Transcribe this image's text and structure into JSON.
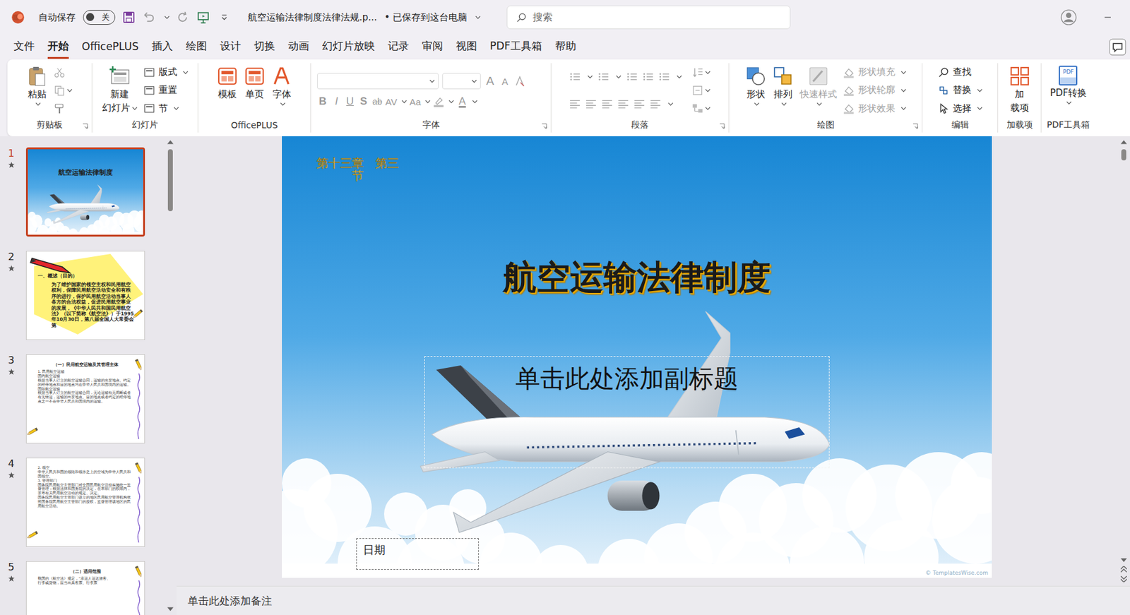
{
  "window": {
    "title": "航空运输法律制度法律法规.p...",
    "save_status": "• 已保存到这台电脑",
    "autosave": {
      "label": "自动保存",
      "toggle": "关",
      "on": false
    }
  },
  "search": {
    "placeholder": "搜索"
  },
  "menu": [
    {
      "label": "文件",
      "selected": false
    },
    {
      "label": "开始",
      "selected": true
    },
    {
      "label": "OfficePLUS",
      "selected": false
    },
    {
      "label": "插入",
      "selected": false
    },
    {
      "label": "绘图",
      "selected": false
    },
    {
      "label": "设计",
      "selected": false
    },
    {
      "label": "切换",
      "selected": false
    },
    {
      "label": "动画",
      "selected": false
    },
    {
      "label": "幻灯片放映",
      "selected": false
    },
    {
      "label": "记录",
      "selected": false
    },
    {
      "label": "审阅",
      "selected": false
    },
    {
      "label": "视图",
      "selected": false
    },
    {
      "label": "PDF工具箱",
      "selected": false
    },
    {
      "label": "帮助",
      "selected": false
    }
  ],
  "ribbon": {
    "clipboard": {
      "label": "剪贴板",
      "paste": "粘贴"
    },
    "slides": {
      "label": "幻灯片",
      "new_slide": [
        "新建",
        "幻灯片"
      ],
      "items": [
        "版式",
        "重置",
        "节"
      ]
    },
    "officeplus": {
      "label": "OfficePLUS",
      "buttons": [
        "模板",
        "单页",
        "字体"
      ]
    },
    "font": {
      "label": "字体",
      "disabled": true,
      "font_name": "",
      "font_size": "",
      "grow": "A",
      "shrink": "A",
      "format_buttons": [
        "B",
        "I",
        "U",
        "S",
        "ab",
        "AV",
        "Aa"
      ],
      "color_letter": "A"
    },
    "paragraph": {
      "label": "段落",
      "disabled": true
    },
    "drawing": {
      "label": "绘图",
      "buttons": [
        {
          "label": "形状",
          "disabled": false
        },
        {
          "label": "排列",
          "disabled": false
        },
        {
          "label": "快速样式",
          "disabled": true
        }
      ],
      "format": [
        {
          "label": "形状填充",
          "disabled": true
        },
        {
          "label": "形状轮廓",
          "disabled": true
        },
        {
          "label": "形状效果",
          "disabled": true
        }
      ]
    },
    "editing": {
      "label": "编辑",
      "buttons": [
        "查找",
        "替换",
        "选择"
      ]
    },
    "addins": {
      "label": "加载项",
      "button": [
        "加",
        "载项"
      ]
    },
    "pdf": {
      "label": "PDF工具箱",
      "button": "PDF转换",
      "icon_text": "PDF"
    }
  },
  "thumbnails": [
    {
      "number": "1",
      "starred": true,
      "selected": true,
      "kind": "title",
      "title": "航空运输法律制度",
      "lines": []
    },
    {
      "number": "2",
      "starred": true,
      "selected": false,
      "kind": "note",
      "title": "一、概述（目的）",
      "lines": [
        "为了维护国家的领空主权和民用航空权利，保障民用航空活动安全和有秩序的进行，保护民用航空活动当事人各方的合法权益，促进民用航空事业的发展，《中华人民共和国民用航空法》（以下简称《航空法》）于1995年10月30日，第八届全国人大常委会第"
      ]
    },
    {
      "number": "3",
      "starred": true,
      "selected": false,
      "kind": "text",
      "title": "（一）民用航空运输及其管理主体",
      "lines": [
        "1. 民用航空运输",
        "国内航空运输",
        "根据当事人订立的航空运输合同，运输的出发地点、约定的经停地点和目的地点均在中华人民共和国境内的运输。",
        "国际航空运输",
        "根据当事人订立的航空运输合同，无论运输有无间断或者有无转运，运输的出发地点、目的地点或者约定的经停地点之一不在中华人民共和国境内的运输。"
      ]
    },
    {
      "number": "4",
      "starred": true,
      "selected": false,
      "kind": "text",
      "title": "",
      "lines": [
        "2. 领空",
        "中华人民共和国的领陆和领水之上的空域为中华人民共和国领空。",
        "3. 管理部门",
        "国务院民用航空主管部门对全国民用航空活动实施统一监督管理；根据法律和国务院的决定，在本部门的权限内，发布有关民用航空活动的规定、决定。",
        "国务院民用航空主管部门设立的地区民用航空管理机构依照国务院民用航空主管部门的授权，监督管理该地区的民用航空活动。"
      ]
    },
    {
      "number": "5",
      "starred": true,
      "selected": false,
      "kind": "text",
      "title": "（二）适用范围",
      "lines": [
        "我国的《航空法》规定，“承运人运送旅客、",
        "行李或货物，应当出具客票、行李票"
      ]
    }
  ],
  "slide": {
    "chapter": "第十三章　第三节",
    "title": "航空运输法律制度",
    "subtitle_placeholder": "单击此处添加副标题",
    "date_placeholder": "日期",
    "copyright": "© TemplatesWise.com"
  },
  "notes": {
    "placeholder": "单击此处添加备注"
  }
}
